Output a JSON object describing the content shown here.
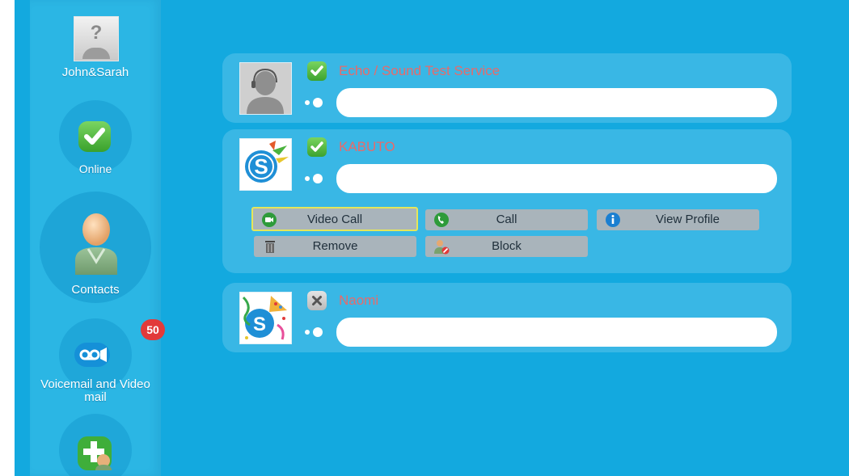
{
  "sidebar": {
    "profile_name": "John&Sarah",
    "avatar_placeholder": "?",
    "items": [
      {
        "label": "Online",
        "icon": "check-icon"
      },
      {
        "label": "Contacts",
        "icon": "person-icon"
      },
      {
        "label": "Voicemail and Video mail",
        "icon": "voicemail-icon",
        "badge": "50"
      },
      {
        "label": "Add contact",
        "icon": "add-contact-icon"
      }
    ]
  },
  "contacts": [
    {
      "name": "Echo / Sound Test Service",
      "status": "online",
      "mood": ""
    },
    {
      "name": "KABUTO",
      "status": "online",
      "mood": ""
    },
    {
      "name": "Naomi",
      "status": "offline",
      "mood": ""
    }
  ],
  "actions": {
    "video_call": "Video Call",
    "call": "Call",
    "view_profile": "View Profile",
    "remove": "Remove",
    "block": "Block"
  },
  "colors": {
    "background": "#13a9df",
    "sidebar": "#2bb6e4",
    "name_text": "#e86a6a",
    "online_green": "#4cb83a",
    "badge_red": "#e23a3a"
  }
}
